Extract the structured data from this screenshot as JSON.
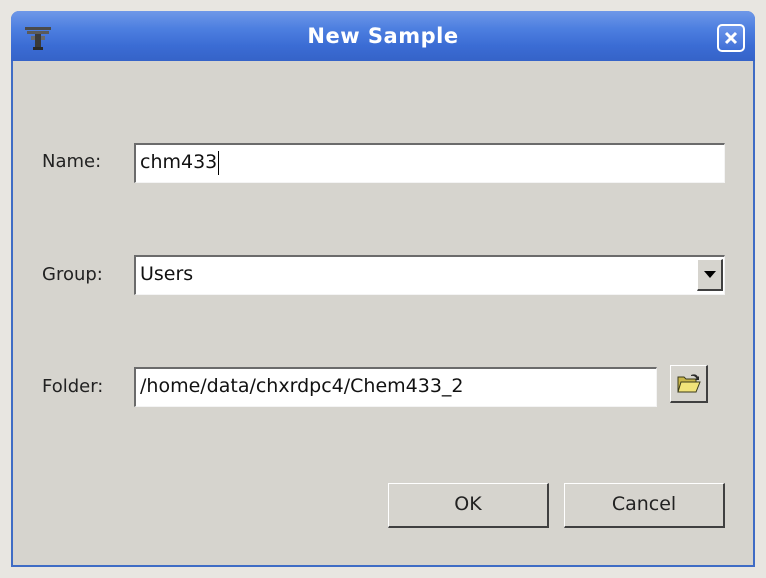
{
  "window": {
    "title": "New Sample"
  },
  "form": {
    "name_label": "Name:",
    "name_value": "chm433",
    "group_label": "Group:",
    "group_value": "Users",
    "folder_label": "Folder:",
    "folder_value": "/home/data/chxrdpc4/Chem433_2"
  },
  "buttons": {
    "ok_label": "OK",
    "cancel_label": "Cancel"
  },
  "icons": {
    "app": "app-icon",
    "close": "close-icon",
    "dropdown": "chevron-down-icon",
    "folder": "folder-open-icon"
  },
  "colors": {
    "titlebar": "#4d7fe0",
    "dialog_bg": "#d6d4ce",
    "border": "#3f6cc5"
  }
}
